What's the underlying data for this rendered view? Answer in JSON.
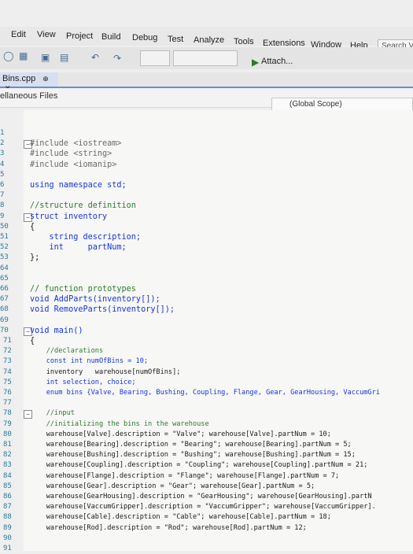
{
  "menu": {
    "items": [
      "Edit",
      "View",
      "Project",
      "Build",
      "Debug",
      "Test",
      "Analyze",
      "Tools",
      "Extensions",
      "Window",
      "Help"
    ],
    "search_placeholder": "Search Vi"
  },
  "toolbar": {
    "attach_label": "Attach...",
    "icons": [
      "back-icon",
      "solution-icon",
      "save-icon",
      "save-all-icon",
      "undo-icon",
      "redo-icon",
      "start-debug-icon"
    ]
  },
  "tabs": {
    "active_file": "Bins.cpp",
    "pin_glyph": "⊕",
    "close_glyph": "✕"
  },
  "navbar": {
    "project_label": "ellaneous Files",
    "scope_label": "(Global Scope)"
  },
  "editor": {
    "lines": [
      {
        "num": "1",
        "text": ""
      },
      {
        "num": "2",
        "text": "#include <iostream>"
      },
      {
        "num": "3",
        "text": "#include <string>"
      },
      {
        "num": "4",
        "text": "#include <iomanip>"
      },
      {
        "num": "5",
        "text": ""
      },
      {
        "num": "6",
        "text": "using namespace std;"
      },
      {
        "num": "7",
        "text": ""
      },
      {
        "num": "8",
        "text": "//structure definition"
      },
      {
        "num": "9",
        "text": "struct inventory"
      },
      {
        "num": "50",
        "text": "{"
      },
      {
        "num": "51",
        "text": "    string description;"
      },
      {
        "num": "52",
        "text": "    int     partNum;"
      },
      {
        "num": "53",
        "text": "};"
      },
      {
        "num": "64",
        "text": ""
      },
      {
        "num": "65",
        "text": ""
      },
      {
        "num": "66",
        "text": "// function prototypes"
      },
      {
        "num": "67",
        "text": "void AddParts(inventory[]);"
      },
      {
        "num": "68",
        "text": "void RemoveParts(inventory[]);"
      },
      {
        "num": "69",
        "text": ""
      },
      {
        "num": "70",
        "text": "void main()"
      },
      {
        "num": "71",
        "text": "{"
      },
      {
        "num": "72",
        "text": "    //declarations"
      },
      {
        "num": "73",
        "text": "    const int numOfBins = 10;"
      },
      {
        "num": "74",
        "text": "    inventory   warehouse[numOfBins];"
      },
      {
        "num": "75",
        "text": "    int selection, choice;"
      },
      {
        "num": "76",
        "text": "    enum bins {Valve, Bearing, Bushing, Coupling, Flange, Gear, GearHousing, VaccumGri"
      },
      {
        "num": "77",
        "text": ""
      },
      {
        "num": "78",
        "text": "    //input"
      },
      {
        "num": "79",
        "text": "    //initializing the bins in the warehouse"
      },
      {
        "num": "80",
        "text": "    warehouse[Valve].description = \"Valve\"; warehouse[Valve].partNum = 10;"
      },
      {
        "num": "81",
        "text": "    warehouse[Bearing].description = \"Bearing\"; warehouse[Bearing].partNum = 5;"
      },
      {
        "num": "82",
        "text": "    warehouse[Bushing].description = \"Bushing\"; warehouse[Bushing].partNum = 15;"
      },
      {
        "num": "83",
        "text": "    warehouse[Coupling].description = \"Coupling\"; warehouse[Coupling].partNum = 21;"
      },
      {
        "num": "84",
        "text": "    warehouse[Flange].description = \"Flange\"; warehouse[Flange].partNum = 7;"
      },
      {
        "num": "85",
        "text": "    warehouse[Gear].description = \"Gear\"; warehouse[Gear].partNum = 5;"
      },
      {
        "num": "86",
        "text": "    warehouse[GearHousing].description = \"GearHousing\"; warehouse[GearHousing].partN"
      },
      {
        "num": "87",
        "text": "    warehouse[VaccumGripper].description = \"VaccumGripper\"; warehouse[VaccumGripper]."
      },
      {
        "num": "88",
        "text": "    warehouse[Cable].description = \"Cable\"; warehouse[Cable].partNum = 18;"
      },
      {
        "num": "89",
        "text": "    warehouse[Rod].description = \"Rod\"; warehouse[Rod].partNum = 12;"
      },
      {
        "num": "90",
        "text": ""
      },
      {
        "num": "91",
        "text": ""
      }
    ]
  },
  "colors": {
    "keyword": "#1536d6",
    "string": "#b3122a",
    "comment": "#2f7a2f",
    "line_number": "#2b7a99",
    "tab_accent": "#6a8fc4"
  }
}
